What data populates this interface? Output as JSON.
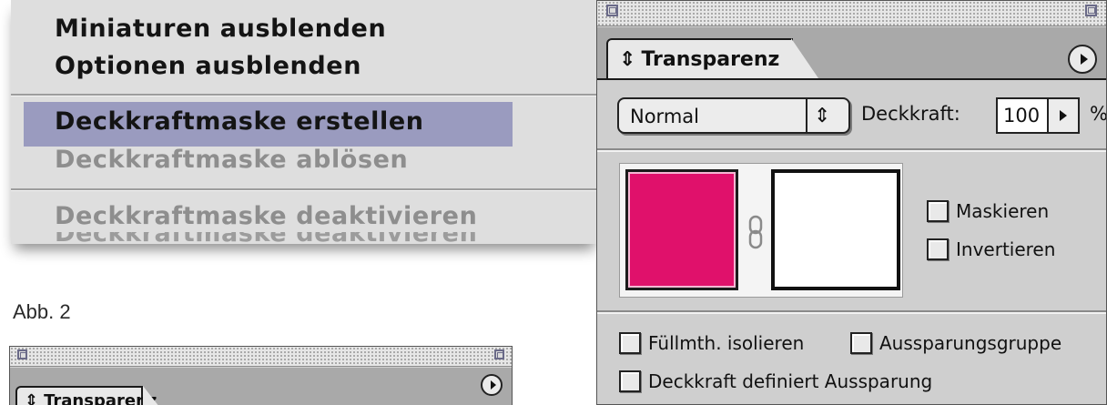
{
  "menu": {
    "items": [
      {
        "label": "Miniaturen ausblenden",
        "enabled": true
      },
      {
        "label": "Optionen ausblenden",
        "enabled": true
      },
      {
        "label": "Deckkraftmaske erstellen",
        "enabled": true,
        "highlighted": true
      },
      {
        "label": "Deckkraftmaske ablösen",
        "enabled": false
      },
      {
        "label": "Deckkraftmaske deaktivieren",
        "enabled": false
      }
    ],
    "highlight_color": "#9a9bbf"
  },
  "caption": "Abb. 2",
  "palette": {
    "tab_label": "Transparenz",
    "blend_mode": "Normal",
    "opacity_label": "Deckkraft:",
    "opacity_value": "100",
    "opacity_unit": "%",
    "object_color": "#e0116b",
    "checkboxes": {
      "mask": {
        "label": "Maskieren",
        "checked": false
      },
      "invert": {
        "label": "Invertieren",
        "checked": false
      },
      "isolate": {
        "label": "Füllmth. isolieren",
        "checked": false
      },
      "knockout_group": {
        "label": "Aussparungsgruppe",
        "checked": false
      },
      "opacity_knockout": {
        "label": "Deckkraft definiert Aussparung",
        "checked": false
      }
    }
  },
  "small_palette": {
    "tab_label": "Transparenz"
  }
}
